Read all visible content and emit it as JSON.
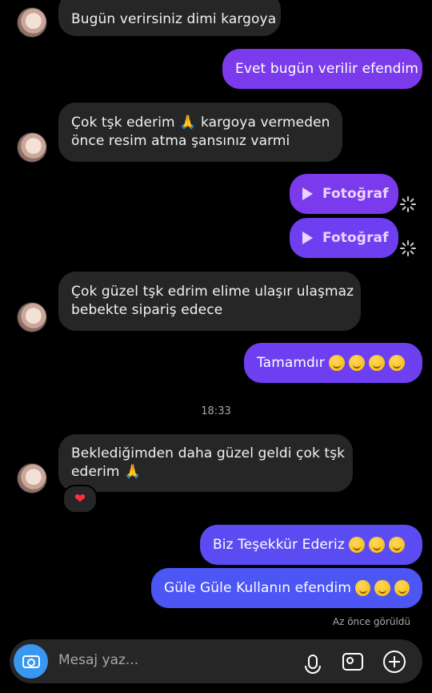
{
  "messages": {
    "m1": "Bugün verirsiniz dimi kargoya",
    "m2": "Evet bugün verilir efendim",
    "m3_line1": "Çok tşk ederim 🙏 kargoya vermeden",
    "m3_line2": "önce resim atma şansınız varmi",
    "photo1": "Fotoğraf",
    "photo2": "Fotoğraf",
    "m4_line1": "Çok güzel tşk edrim elime ulaşır ulaşmaz",
    "m4_line2": "bebekte sipariş edece",
    "m5": "Tamamdır",
    "timestamp": "18:33",
    "m6_line1": "Beklediğimden daha güzel geldi çok tşk",
    "m6_line2": "ederim 🙏",
    "reaction": "❤",
    "m7": "Biz Teşekkür Ederiz",
    "m8": "Güle Güle Kullanın efendim"
  },
  "status": {
    "seen": "Az önce görüldü"
  },
  "composer": {
    "placeholder": "Mesaj yaz..."
  },
  "icons": {
    "camera": "camera-icon",
    "mic": "microphone-icon",
    "gallery": "gallery-icon",
    "plus": "plus-icon",
    "play": "play-icon",
    "spinner": "sending-spinner-icon",
    "hug_emoji": "hugging-face-emoji"
  },
  "colors": {
    "background": "#000000",
    "incoming_bubble": "#262626",
    "outgoing_bubble_top": "#7c3aed",
    "outgoing_bubble_bottom": "#4b56f5",
    "camera_button": "#3897f0",
    "reaction_heart": "#ff3040"
  }
}
